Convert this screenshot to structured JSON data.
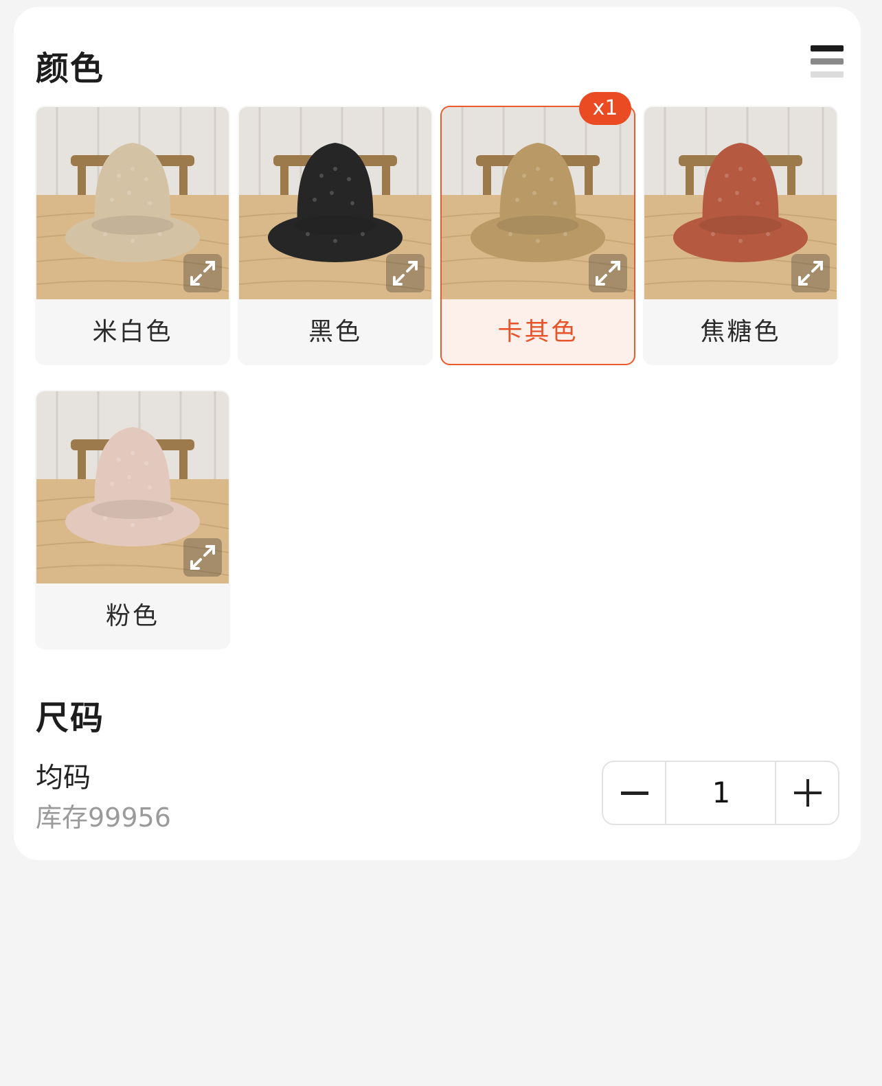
{
  "color_section": {
    "title": "颜色",
    "view_toggle_icon": "list-view-icon",
    "options": [
      {
        "label": "米白色",
        "hat_color": "#d4c2a4",
        "selected": false
      },
      {
        "label": "黑色",
        "hat_color": "#262626",
        "selected": false
      },
      {
        "label": "卡其色",
        "hat_color": "#b99a66",
        "selected": true,
        "badge": "x1"
      },
      {
        "label": "焦糖色",
        "hat_color": "#b55a41",
        "selected": false
      },
      {
        "label": "粉色",
        "hat_color": "#e3c9bd",
        "selected": false
      }
    ],
    "zoom_icon": "expand-icon"
  },
  "size_section": {
    "title": "尺码",
    "size_name": "均码",
    "stock": "库存99956",
    "quantity": "1",
    "minus_icon": "minus-icon",
    "plus_icon": "plus-icon"
  },
  "colors": {
    "accent": "#ea4b22",
    "selected_bg": "#fdf0ea"
  }
}
